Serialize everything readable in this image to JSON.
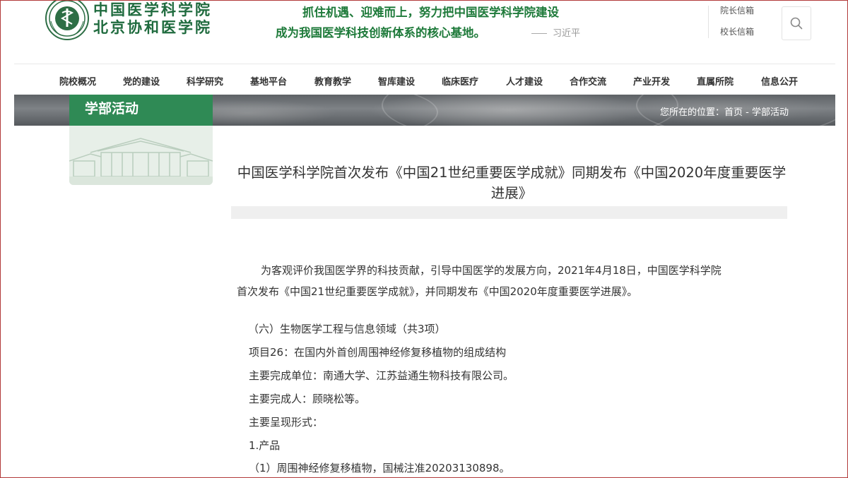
{
  "header": {
    "logo_line1": "中国医学科学院",
    "logo_line2": "北京协和医学院",
    "logo_icon": "institution-emblem",
    "slogan_line1": "抓住机遇、迎难而上，努力把中国医学科学院建设",
    "slogan_line2": "成为我国医学科技创新体系的核心基地。",
    "slogan_author": "习近平",
    "mailbox_president": "院长信箱",
    "mailbox_principal": "校长信箱",
    "search_icon": "search-icon"
  },
  "nav": {
    "items": [
      {
        "label": "院校概况"
      },
      {
        "label": "党的建设"
      },
      {
        "label": "科学研究"
      },
      {
        "label": "基地平台"
      },
      {
        "label": "教育教学"
      },
      {
        "label": "智库建设"
      },
      {
        "label": "临床医疗"
      },
      {
        "label": "人才建设"
      },
      {
        "label": "合作交流"
      },
      {
        "label": "产业开发"
      },
      {
        "label": "直属所院"
      },
      {
        "label": "信息公开"
      }
    ]
  },
  "banner": {
    "breadcrumb_prefix": "您所在的位置：",
    "breadcrumb_home": "首页",
    "breadcrumb_sep": " - ",
    "breadcrumb_current": "学部活动"
  },
  "sidebar": {
    "title": "学部活动"
  },
  "article": {
    "title": "中国医学科学院首次发布《中国21世纪重要医学成就》同期发布《中国2020年度重要医学进展》",
    "intro_line1": "为客观评价我国医学界的科技贡献，引导中国医学的发展方向，2021年4月18日，中国医学科学院",
    "intro_line2": "首次发布《中国21世纪重要医学成就》，并同期发布《中国2020年度重要医学进展》。",
    "section": "（六）生物医学工程与信息领域（共3项）",
    "item": "项目26：在国内外首创周围神经修复移植物的组成结构",
    "unit": "主要完成单位：南通大学、江苏益通生物科技有限公司。",
    "person": "主要完成人：顾晓松等。",
    "form": "主要呈现形式：",
    "product": "1.产品",
    "product_detail": "（1）周围神经修复移植物，国械注准20203130898。"
  },
  "colors": {
    "brand_green": "#2f8a55",
    "slogan_green": "#1e7a3a",
    "frame_red": "#b23a3a"
  }
}
